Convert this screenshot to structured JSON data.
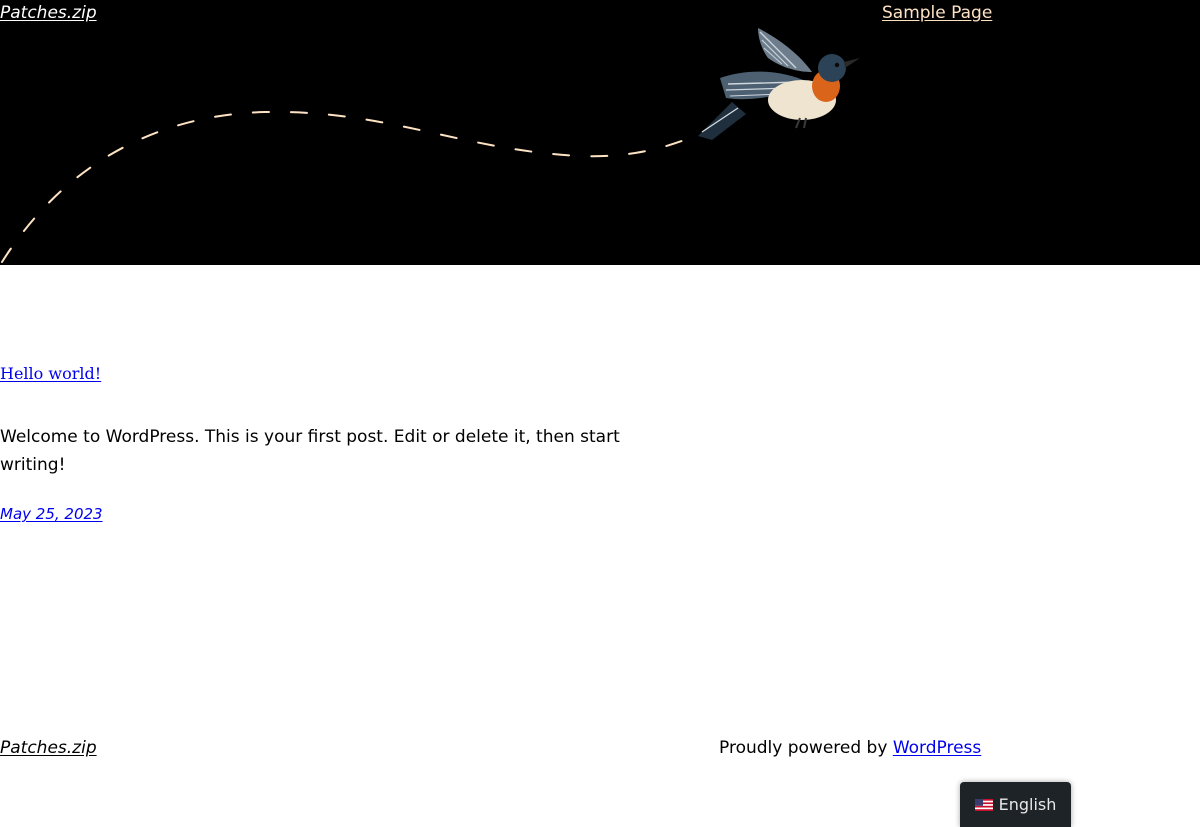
{
  "header": {
    "site_title": "Patches.zip",
    "nav": [
      {
        "label": "Sample Page"
      }
    ]
  },
  "post": {
    "title": "Hello world!",
    "excerpt": "Welcome to WordPress. This is your first post. Edit or delete it, then start writing!",
    "date": "May 25, 2023"
  },
  "footer": {
    "site_title": "Patches.zip",
    "credit_prefix": "Proudly powered by",
    "credit_link": "WordPress"
  },
  "language_switcher": {
    "label": "English",
    "flag_icon": "us-flag-icon"
  },
  "colors": {
    "hero_background": "#000000",
    "nav_link": "#fde2c4",
    "link": "#0000ee",
    "dashed_path": "#fde2c4"
  }
}
